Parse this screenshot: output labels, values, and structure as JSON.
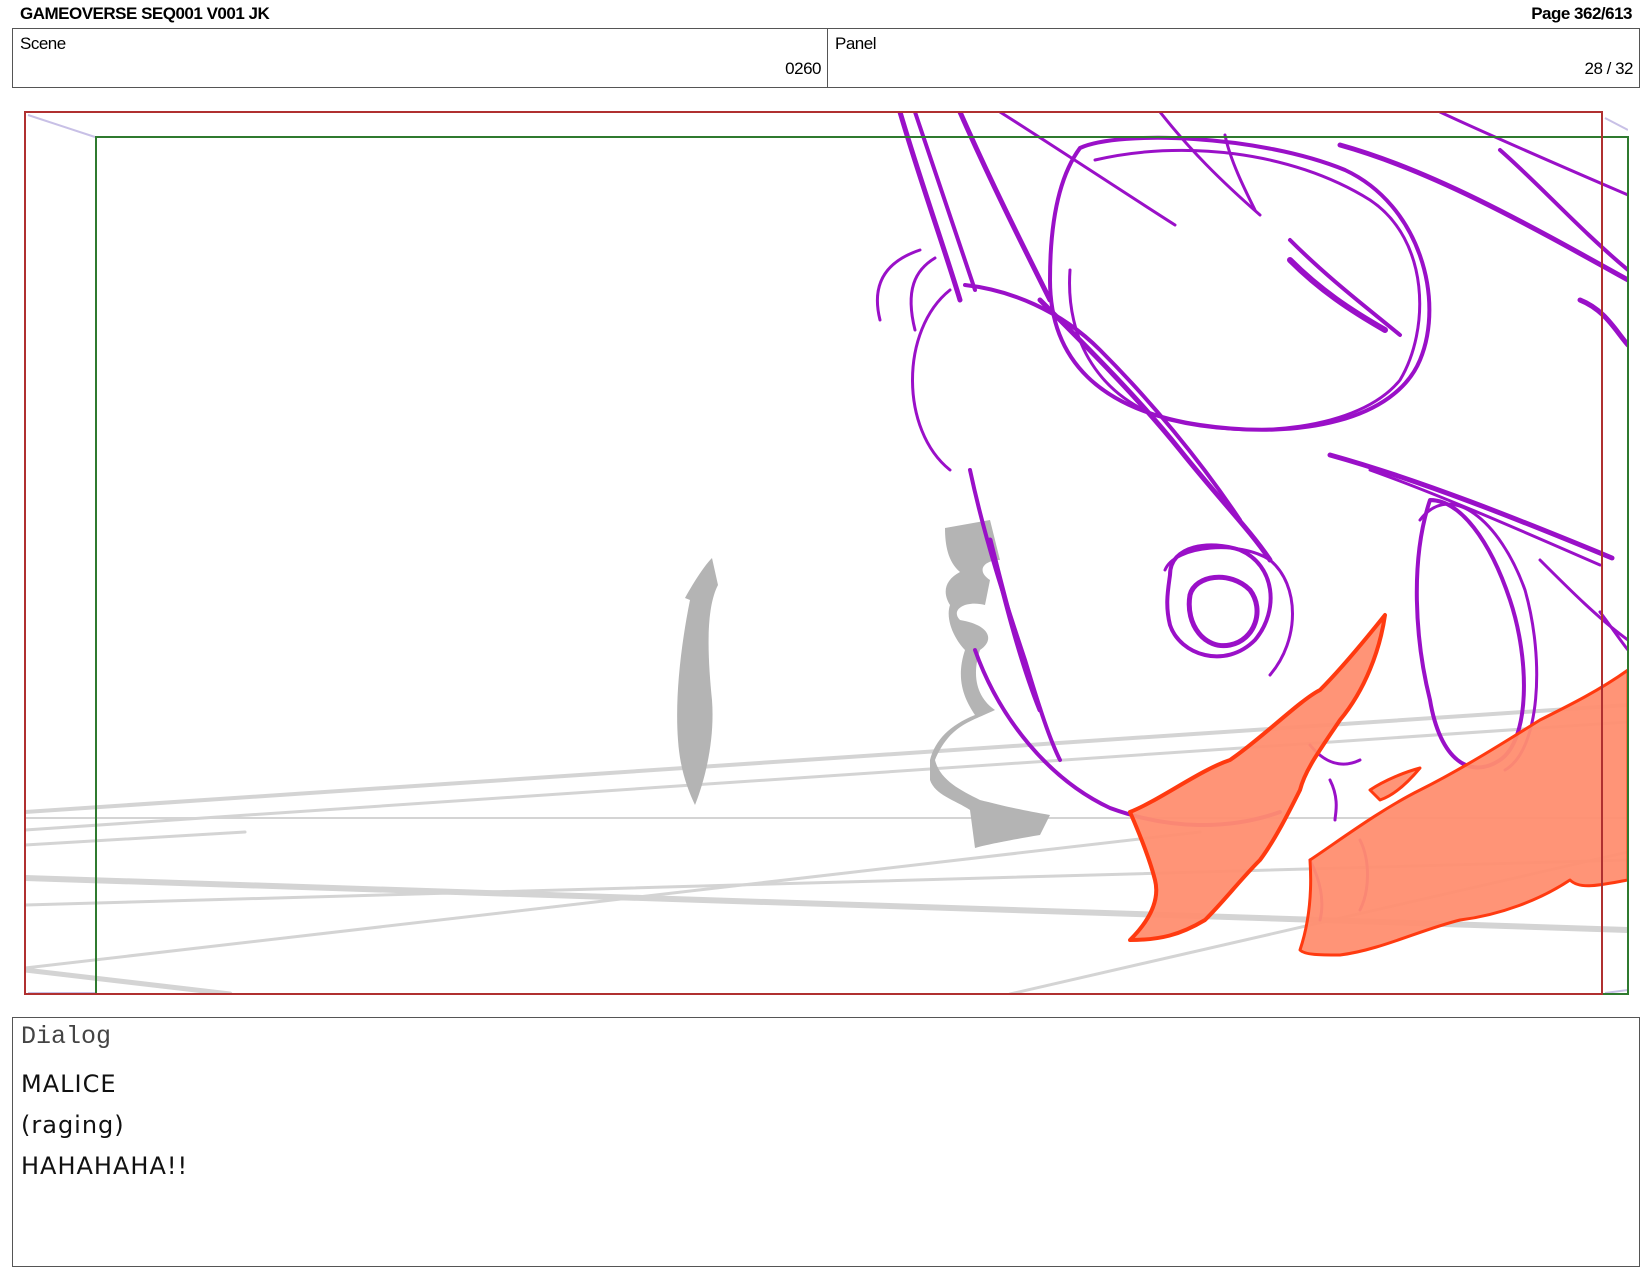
{
  "header": {
    "document_title": "GAMEOVERSE SEQ001 V001 JK",
    "page": "Page 362/613"
  },
  "info": {
    "scene_label": "Scene",
    "scene_value": "0260",
    "panel_label": "Panel",
    "panel_value": "28 / 32"
  },
  "frame": {
    "colors": {
      "outer_frame": "#b03030",
      "safe_frame": "#2f7a2f",
      "sketch_purple": "#9a10c8",
      "flame_stroke": "#ff3a10",
      "flame_fill": "#ff8e70",
      "shadow_gray": "#b4b4b4",
      "guide_gray": "#d4d4d4"
    }
  },
  "dialog": {
    "label": "Dialog",
    "lines": [
      "MALICE",
      "(raging)",
      "HAHAHAHA!!"
    ]
  }
}
